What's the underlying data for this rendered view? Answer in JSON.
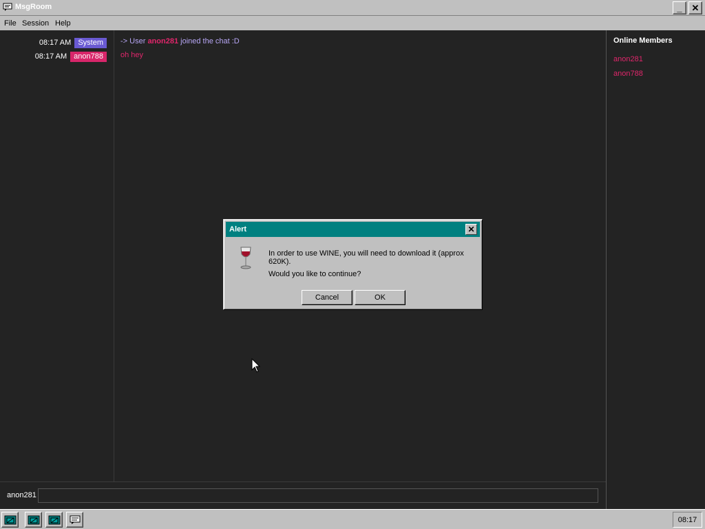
{
  "window": {
    "title": "MsgRoom",
    "minimize_label": "_",
    "close_label": "✕"
  },
  "menu": [
    "File",
    "Session",
    "Help"
  ],
  "timeline": [
    {
      "time": "08:17 AM",
      "tag": "System",
      "tag_color": "#6a5ad2"
    },
    {
      "time": "08:17 AM",
      "tag": "anon788",
      "tag_color": "#d8266a"
    }
  ],
  "messages": {
    "system": {
      "prefix": "-> User",
      "user": "anon281",
      "suffix": "joined the chat :D"
    },
    "user": {
      "text": "oh hey"
    }
  },
  "members": {
    "header": "Online Members",
    "list": [
      "anon281",
      "anon788"
    ]
  },
  "input": {
    "nick": "anon281",
    "value": ""
  },
  "taskbar": {
    "icons": [
      "program-icon",
      "program-icon",
      "program-icon",
      "chat-icon"
    ],
    "clock": "08:17"
  },
  "dialog": {
    "title": "Alert",
    "close_label": "✕",
    "line1": "In order to use WINE, you will need to download it (approx 620K).",
    "line2": "Would you like to continue?",
    "cancel_label": "Cancel",
    "ok_label": "OK",
    "icon": "wine-glass-icon"
  },
  "colors": {
    "chat_bg": "#232323",
    "accent": "#e0266b",
    "system": "#b7a6f5",
    "dialog_title": "#008080"
  }
}
